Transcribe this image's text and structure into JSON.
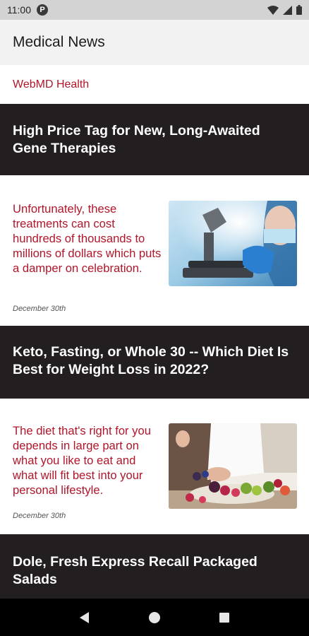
{
  "status_bar": {
    "time": "11:00",
    "notification_badge": "P",
    "icons": [
      "wifi-icon",
      "signal-icon",
      "battery-icon"
    ]
  },
  "app_bar": {
    "title": "Medical News"
  },
  "source": {
    "name": "WebMD Health"
  },
  "articles": [
    {
      "title": "High Price Tag for New, Long-Awaited Gene Therapies",
      "summary": "Unfortunately, these treatments can cost hundreds of thousands to millions of dollars which puts a damper on celebration.",
      "date": "December 30th",
      "image": "lab-microscope-photo"
    },
    {
      "title": "Keto, Fasting, or Whole 30 -- Which Diet Is Best for Weight Loss in 2022?",
      "summary": "The diet that's right for you depends in large part on what you like to eat and what will fit best into your personal lifestyle.",
      "date": "December 30th",
      "image": "fruit-plate-photo"
    },
    {
      "title": "Dole, Fresh Express Recall Packaged Salads"
    }
  ],
  "nav_bar": {
    "icons": [
      "back-icon",
      "home-icon",
      "recents-icon"
    ]
  },
  "colors": {
    "accent_red": "#b0162a",
    "headline_bg": "#231f20",
    "app_bar_bg": "#f2f2f2",
    "status_bar_bg": "#d3d3d3"
  }
}
